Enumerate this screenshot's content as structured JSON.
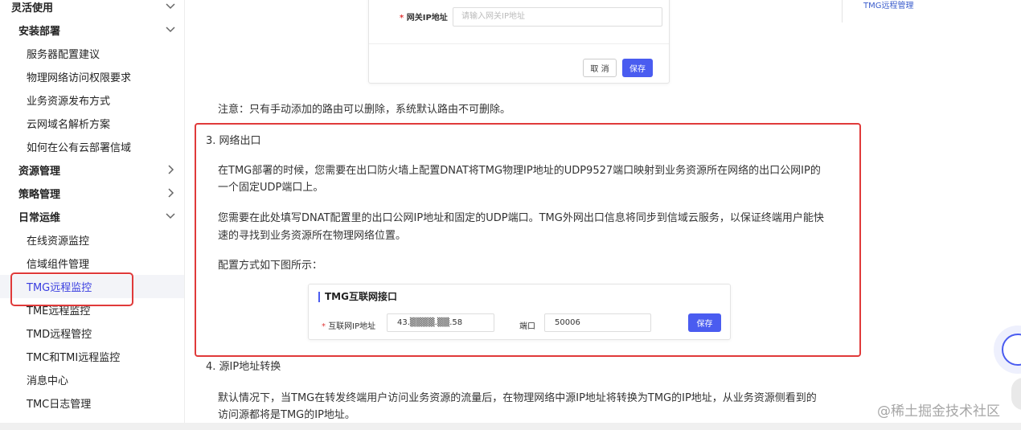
{
  "sidebar": {
    "items": [
      {
        "label": "灵活使用",
        "level": 1,
        "chevron": "chevron-down-icon"
      },
      {
        "label": "安装部署",
        "level": 2,
        "chevron": "chevron-down-icon"
      },
      {
        "label": "服务器配置建议",
        "level": 3
      },
      {
        "label": "物理网络访问权限要求",
        "level": 3
      },
      {
        "label": "业务资源发布方式",
        "level": 3
      },
      {
        "label": "云网域名解析方案",
        "level": 3
      },
      {
        "label": "如何在公有云部署信域",
        "level": 3
      },
      {
        "label": "资源管理",
        "level": 2,
        "chevron": "chevron-right-icon"
      },
      {
        "label": "策略管理",
        "level": 2,
        "chevron": "chevron-right-icon"
      },
      {
        "label": "日常运维",
        "level": 2,
        "chevron": "chevron-down-icon"
      },
      {
        "label": "在线资源监控",
        "level": 3
      },
      {
        "label": "信域组件管理",
        "level": 3
      },
      {
        "label": "TMG远程监控",
        "level": 3,
        "active": true
      },
      {
        "label": "TME远程监控",
        "level": 3
      },
      {
        "label": "TMD远程管控",
        "level": 3
      },
      {
        "label": "TMC和TMI远程监控",
        "level": 3
      },
      {
        "label": "消息中心",
        "level": 3
      },
      {
        "label": "TMC日志管理",
        "level": 3
      }
    ]
  },
  "form_card": {
    "gateway_ip_label": "网关IP地址",
    "gateway_ip_placeholder": "请输入网关IP地址",
    "cancel_label": "取 消",
    "save_label": "保存"
  },
  "content": {
    "note": "注意：只有手动添加的路由可以删除，系统默认路由不可删除。",
    "section3_title": "3. 网络出口",
    "para1_line1": "在TMG部署的时候，您需要在出口防火墙上配置DNAT将TMG物理IP地址的UDP9527端口映射到业务资源所在网络的出口公网IP的",
    "para1_line2": "一个固定UDP端口上。",
    "para2_line1": "您需要在此处填写DNAT配置里的出口公网IP地址和固定的UDP端口。TMG外网出口信息将同步到信域云服务，以保证终端用户能快",
    "para2_line2": "速的寻找到业务资源所在物理网络位置。",
    "config_intro": "配置方式如下图所示：",
    "section4_title": "4. 源IP地址转换",
    "para4_line1": "默认情况下，当TMG在转发终端用户访问业务资源的流量后，在物理网络中源IP地址将转换为TMG的IP地址，从业务资源侧看到的",
    "para4_line2": "访问源都将是TMG的IP地址。"
  },
  "tmg_card": {
    "title": "TMG互联网接口",
    "ip_label": "互联网IP地址",
    "ip_value": "43.▒▒▒▒.▒▒.58",
    "port_label": "端口",
    "port_value": "50006",
    "save_label": "保存"
  },
  "toc": {
    "item": "TMG远程管理"
  },
  "watermark": "@稀土掘金技术社区",
  "colors": {
    "accent": "#4a5cf0",
    "highlight": "#e03a3a",
    "active_text": "#3a3ee0"
  }
}
